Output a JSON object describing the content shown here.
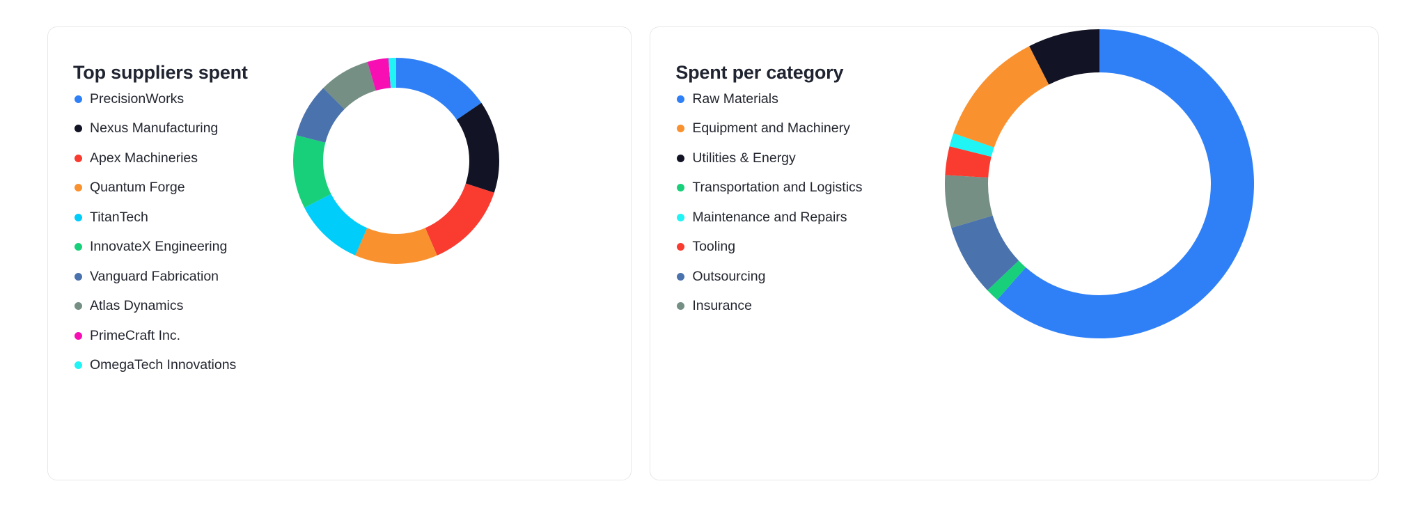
{
  "page": {
    "background": "#ffffff",
    "card_border": "#e8e8ea",
    "text_color": "#23262f"
  },
  "cards": [
    {
      "id": "top-suppliers-spent",
      "title": "Top suppliers spent",
      "legend": [
        {
          "label": "PrecisionWorks",
          "color": "#2f80f7"
        },
        {
          "label": "Nexus Manufacturing",
          "color": "#121324"
        },
        {
          "label": "Apex Machineries",
          "color": "#f93b30"
        },
        {
          "label": "Quantum Forge",
          "color": "#f9912f"
        },
        {
          "label": "TitanTech",
          "color": "#00cdf9"
        },
        {
          "label": "InnovateX Engineering",
          "color": "#19d07a"
        },
        {
          "label": "Vanguard Fabrication",
          "color": "#4a72ad"
        },
        {
          "label": "Atlas Dynamics",
          "color": "#758f84"
        },
        {
          "label": "PrimeCraft Inc.",
          "color": "#f70fb4"
        },
        {
          "label": "OmegaTech Innovations",
          "color": "#20f4f4"
        }
      ]
    },
    {
      "id": "spent-per-category",
      "title": "Spent per category",
      "legend": [
        {
          "label": "Raw Materials",
          "color": "#2f80f7"
        },
        {
          "label": "Equipment and Machinery",
          "color": "#f9912f"
        },
        {
          "label": "Utilities & Energy",
          "color": "#121324"
        },
        {
          "label": "Transportation and Logistics",
          "color": "#19d07a"
        },
        {
          "label": "Maintenance and Repairs",
          "color": "#20f4f4"
        },
        {
          "label": "Tooling",
          "color": "#f93b30"
        },
        {
          "label": "Outsourcing",
          "color": "#4a72ad"
        },
        {
          "label": "Insurance",
          "color": "#758f84"
        }
      ]
    }
  ],
  "chart_data": [
    {
      "type": "pie",
      "variant": "donut",
      "title": "Top suppliers spent",
      "legend_position": "left",
      "start_angle_deg": 0,
      "direction": "clockwise",
      "inner_radius_ratio": 0.71,
      "labels": [
        "PrecisionWorks",
        "Nexus Manufacturing",
        "Apex Machineries",
        "Quantum Forge",
        "TitanTech",
        "InnovateX Engineering",
        "Vanguard Fabrication",
        "Atlas Dynamics",
        "PrimeCraft Inc.",
        "OmegaTech Innovations"
      ],
      "colors": [
        "#2f80f7",
        "#121324",
        "#f93b30",
        "#f9912f",
        "#00cdf9",
        "#19d07a",
        "#4a72ad",
        "#758f84",
        "#f70fb4",
        "#20f4f4"
      ],
      "values": [
        15.5,
        14.5,
        13.5,
        13.0,
        11.0,
        11.5,
        8.5,
        8.0,
        3.3,
        1.2
      ],
      "units": "percent"
    },
    {
      "type": "pie",
      "variant": "donut",
      "title": "Spent per category",
      "legend_position": "left",
      "start_angle_deg": 0,
      "direction": "clockwise",
      "inner_radius_ratio": 0.72,
      "labels": [
        "Raw Materials",
        "Transportation and Logistics",
        "Outsourcing",
        "Insurance",
        "Tooling",
        "Maintenance and Repairs",
        "Equipment and Machinery",
        "Utilities & Energy"
      ],
      "colors": [
        "#2f80f7",
        "#19d07a",
        "#4a72ad",
        "#758f84",
        "#f93b30",
        "#20f4f4",
        "#f9912f",
        "#121324"
      ],
      "values": [
        61.5,
        1.4,
        7.5,
        5.5,
        3.0,
        1.4,
        12.2,
        7.5
      ],
      "units": "percent"
    }
  ]
}
